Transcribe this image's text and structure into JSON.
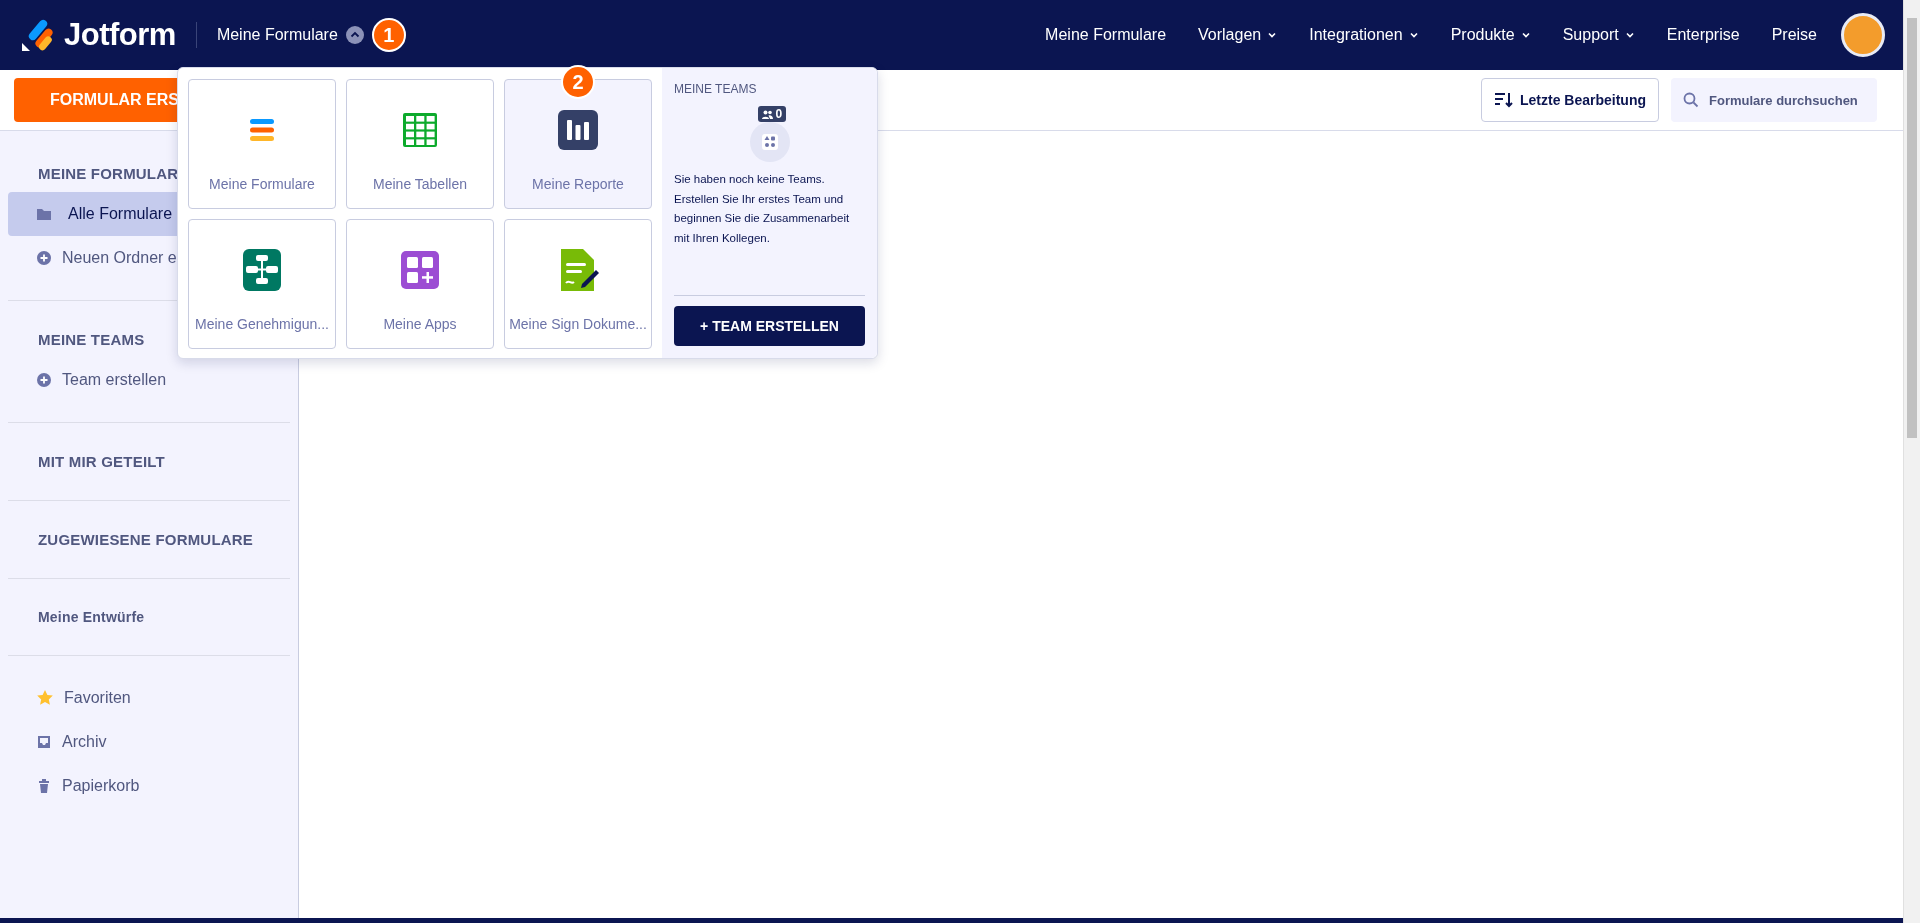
{
  "header": {
    "logo": "Jotform",
    "menu_label": "Meine Formulare",
    "menu_expanded": true,
    "step_badge": "1",
    "nav": [
      {
        "label": "Meine Formulare",
        "dropdown": false
      },
      {
        "label": "Vorlagen",
        "dropdown": true
      },
      {
        "label": "Integrationen",
        "dropdown": true
      },
      {
        "label": "Produkte",
        "dropdown": true
      },
      {
        "label": "Support",
        "dropdown": true
      },
      {
        "label": "Enterprise",
        "dropdown": false
      },
      {
        "label": "Preise",
        "dropdown": false
      }
    ]
  },
  "toolbar": {
    "create_button": "FORMULAR ERS",
    "sort_button": "Letzte Bearbeitung",
    "search": {
      "placeholder": "Formulare durchsuchen"
    }
  },
  "sidebar": {
    "groups": [
      {
        "title": "MEINE FORMULAR",
        "items": [
          {
            "label": "Alle Formulare",
            "kind": "folder",
            "selected": true
          },
          {
            "label": "Neuen Ordner e",
            "kind": "add",
            "selected": false
          }
        ]
      },
      {
        "title": "MEINE TEAMS",
        "items": [
          {
            "label": "Team erstellen",
            "kind": "add",
            "selected": false
          }
        ]
      },
      {
        "title": "MIT MIR GETEILT"
      },
      {
        "title": "ZUGEWIESENE FORMULARE"
      },
      {
        "title": "Meine Entwürfe"
      },
      {
        "items": [
          {
            "label": "Favoriten",
            "kind": "star",
            "selected": false
          },
          {
            "label": "Archiv",
            "kind": "archive",
            "selected": false
          },
          {
            "label": "Papierkorb",
            "kind": "trash",
            "selected": false
          }
        ]
      }
    ]
  },
  "dropdown": {
    "tiles": [
      {
        "label": "Meine Formulare",
        "kind": "forms",
        "selected": false
      },
      {
        "label": "Meine Tabellen",
        "kind": "tables",
        "selected": false
      },
      {
        "label": "Meine Reporte",
        "kind": "reports",
        "selected": true,
        "step_badge": "2"
      },
      {
        "label": "Meine Genehmigun...",
        "kind": "approvals",
        "selected": false
      },
      {
        "label": "Meine Apps",
        "kind": "apps",
        "selected": false
      },
      {
        "label": "Meine Sign Dokume...",
        "kind": "sign",
        "selected": false
      }
    ],
    "teams": {
      "title": "MEINE TEAMS",
      "count": "0",
      "text": "Sie haben noch keine Teams. Erstellen Sie Ihr erstes Team und beginnen Sie die Zusammenarbeit mit Ihren Kollegen.",
      "button": "+ TEAM ERSTELLEN"
    }
  }
}
